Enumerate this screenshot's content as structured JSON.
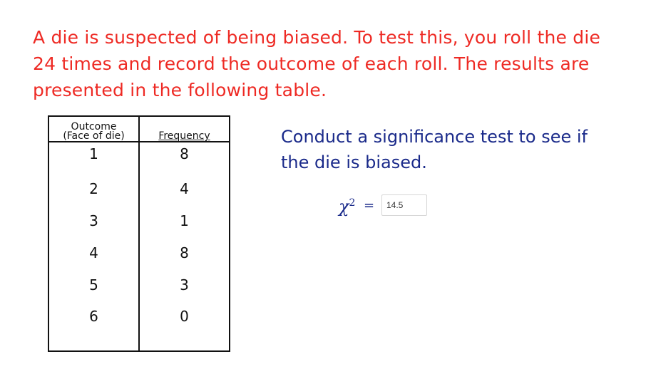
{
  "problem": {
    "lines": [
      "A die is suspected of being biased. To test this, you roll the die",
      "24 times and record the outcome of each roll. The results are",
      "presented in the following table."
    ]
  },
  "table": {
    "header_col1_line1": "Outcome",
    "header_col1_line2": "(Face of die)",
    "header_col2": "Frequency",
    "rows": [
      {
        "outcome": "1",
        "frequency": "8"
      },
      {
        "outcome": "2",
        "frequency": "4"
      },
      {
        "outcome": "3",
        "frequency": "1"
      },
      {
        "outcome": "4",
        "frequency": "8"
      },
      {
        "outcome": "5",
        "frequency": "3"
      },
      {
        "outcome": "6",
        "frequency": "0"
      }
    ]
  },
  "prompt": {
    "lines": [
      "Conduct a significance test to see if",
      "the die is biased."
    ]
  },
  "chi_square": {
    "symbol": "χ",
    "exponent": "2",
    "equals": "=",
    "answer_value": "14.5"
  },
  "colors": {
    "problem_text": "#ee2a24",
    "prompt_text": "#1a2a8a",
    "table_border": "#111111"
  }
}
